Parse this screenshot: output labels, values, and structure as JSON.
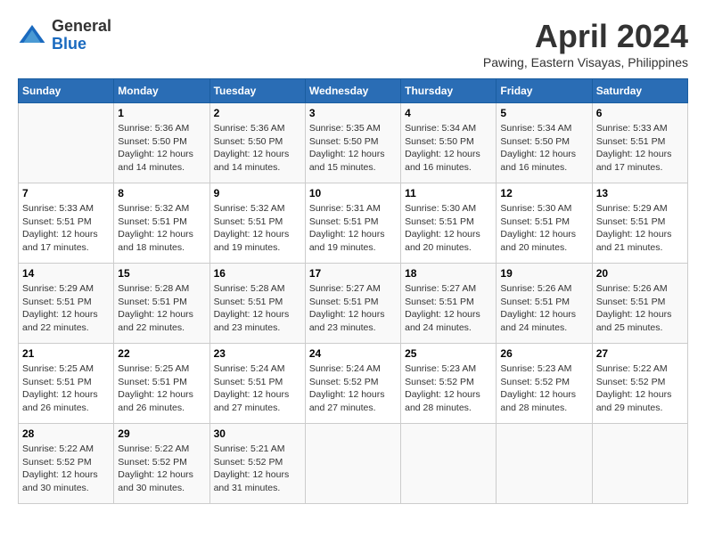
{
  "header": {
    "logo_line1": "General",
    "logo_line2": "Blue",
    "month_title": "April 2024",
    "location": "Pawing, Eastern Visayas, Philippines"
  },
  "days_of_week": [
    "Sunday",
    "Monday",
    "Tuesday",
    "Wednesday",
    "Thursday",
    "Friday",
    "Saturday"
  ],
  "weeks": [
    [
      {
        "day": "",
        "sunrise": "",
        "sunset": "",
        "daylight": ""
      },
      {
        "day": "1",
        "sunrise": "Sunrise: 5:36 AM",
        "sunset": "Sunset: 5:50 PM",
        "daylight": "Daylight: 12 hours and 14 minutes."
      },
      {
        "day": "2",
        "sunrise": "Sunrise: 5:36 AM",
        "sunset": "Sunset: 5:50 PM",
        "daylight": "Daylight: 12 hours and 14 minutes."
      },
      {
        "day": "3",
        "sunrise": "Sunrise: 5:35 AM",
        "sunset": "Sunset: 5:50 PM",
        "daylight": "Daylight: 12 hours and 15 minutes."
      },
      {
        "day": "4",
        "sunrise": "Sunrise: 5:34 AM",
        "sunset": "Sunset: 5:50 PM",
        "daylight": "Daylight: 12 hours and 16 minutes."
      },
      {
        "day": "5",
        "sunrise": "Sunrise: 5:34 AM",
        "sunset": "Sunset: 5:50 PM",
        "daylight": "Daylight: 12 hours and 16 minutes."
      },
      {
        "day": "6",
        "sunrise": "Sunrise: 5:33 AM",
        "sunset": "Sunset: 5:51 PM",
        "daylight": "Daylight: 12 hours and 17 minutes."
      }
    ],
    [
      {
        "day": "7",
        "sunrise": "Sunrise: 5:33 AM",
        "sunset": "Sunset: 5:51 PM",
        "daylight": "Daylight: 12 hours and 17 minutes."
      },
      {
        "day": "8",
        "sunrise": "Sunrise: 5:32 AM",
        "sunset": "Sunset: 5:51 PM",
        "daylight": "Daylight: 12 hours and 18 minutes."
      },
      {
        "day": "9",
        "sunrise": "Sunrise: 5:32 AM",
        "sunset": "Sunset: 5:51 PM",
        "daylight": "Daylight: 12 hours and 19 minutes."
      },
      {
        "day": "10",
        "sunrise": "Sunrise: 5:31 AM",
        "sunset": "Sunset: 5:51 PM",
        "daylight": "Daylight: 12 hours and 19 minutes."
      },
      {
        "day": "11",
        "sunrise": "Sunrise: 5:30 AM",
        "sunset": "Sunset: 5:51 PM",
        "daylight": "Daylight: 12 hours and 20 minutes."
      },
      {
        "day": "12",
        "sunrise": "Sunrise: 5:30 AM",
        "sunset": "Sunset: 5:51 PM",
        "daylight": "Daylight: 12 hours and 20 minutes."
      },
      {
        "day": "13",
        "sunrise": "Sunrise: 5:29 AM",
        "sunset": "Sunset: 5:51 PM",
        "daylight": "Daylight: 12 hours and 21 minutes."
      }
    ],
    [
      {
        "day": "14",
        "sunrise": "Sunrise: 5:29 AM",
        "sunset": "Sunset: 5:51 PM",
        "daylight": "Daylight: 12 hours and 22 minutes."
      },
      {
        "day": "15",
        "sunrise": "Sunrise: 5:28 AM",
        "sunset": "Sunset: 5:51 PM",
        "daylight": "Daylight: 12 hours and 22 minutes."
      },
      {
        "day": "16",
        "sunrise": "Sunrise: 5:28 AM",
        "sunset": "Sunset: 5:51 PM",
        "daylight": "Daylight: 12 hours and 23 minutes."
      },
      {
        "day": "17",
        "sunrise": "Sunrise: 5:27 AM",
        "sunset": "Sunset: 5:51 PM",
        "daylight": "Daylight: 12 hours and 23 minutes."
      },
      {
        "day": "18",
        "sunrise": "Sunrise: 5:27 AM",
        "sunset": "Sunset: 5:51 PM",
        "daylight": "Daylight: 12 hours and 24 minutes."
      },
      {
        "day": "19",
        "sunrise": "Sunrise: 5:26 AM",
        "sunset": "Sunset: 5:51 PM",
        "daylight": "Daylight: 12 hours and 24 minutes."
      },
      {
        "day": "20",
        "sunrise": "Sunrise: 5:26 AM",
        "sunset": "Sunset: 5:51 PM",
        "daylight": "Daylight: 12 hours and 25 minutes."
      }
    ],
    [
      {
        "day": "21",
        "sunrise": "Sunrise: 5:25 AM",
        "sunset": "Sunset: 5:51 PM",
        "daylight": "Daylight: 12 hours and 26 minutes."
      },
      {
        "day": "22",
        "sunrise": "Sunrise: 5:25 AM",
        "sunset": "Sunset: 5:51 PM",
        "daylight": "Daylight: 12 hours and 26 minutes."
      },
      {
        "day": "23",
        "sunrise": "Sunrise: 5:24 AM",
        "sunset": "Sunset: 5:51 PM",
        "daylight": "Daylight: 12 hours and 27 minutes."
      },
      {
        "day": "24",
        "sunrise": "Sunrise: 5:24 AM",
        "sunset": "Sunset: 5:52 PM",
        "daylight": "Daylight: 12 hours and 27 minutes."
      },
      {
        "day": "25",
        "sunrise": "Sunrise: 5:23 AM",
        "sunset": "Sunset: 5:52 PM",
        "daylight": "Daylight: 12 hours and 28 minutes."
      },
      {
        "day": "26",
        "sunrise": "Sunrise: 5:23 AM",
        "sunset": "Sunset: 5:52 PM",
        "daylight": "Daylight: 12 hours and 28 minutes."
      },
      {
        "day": "27",
        "sunrise": "Sunrise: 5:22 AM",
        "sunset": "Sunset: 5:52 PM",
        "daylight": "Daylight: 12 hours and 29 minutes."
      }
    ],
    [
      {
        "day": "28",
        "sunrise": "Sunrise: 5:22 AM",
        "sunset": "Sunset: 5:52 PM",
        "daylight": "Daylight: 12 hours and 30 minutes."
      },
      {
        "day": "29",
        "sunrise": "Sunrise: 5:22 AM",
        "sunset": "Sunset: 5:52 PM",
        "daylight": "Daylight: 12 hours and 30 minutes."
      },
      {
        "day": "30",
        "sunrise": "Sunrise: 5:21 AM",
        "sunset": "Sunset: 5:52 PM",
        "daylight": "Daylight: 12 hours and 31 minutes."
      },
      {
        "day": "",
        "sunrise": "",
        "sunset": "",
        "daylight": ""
      },
      {
        "day": "",
        "sunrise": "",
        "sunset": "",
        "daylight": ""
      },
      {
        "day": "",
        "sunrise": "",
        "sunset": "",
        "daylight": ""
      },
      {
        "day": "",
        "sunrise": "",
        "sunset": "",
        "daylight": ""
      }
    ]
  ]
}
